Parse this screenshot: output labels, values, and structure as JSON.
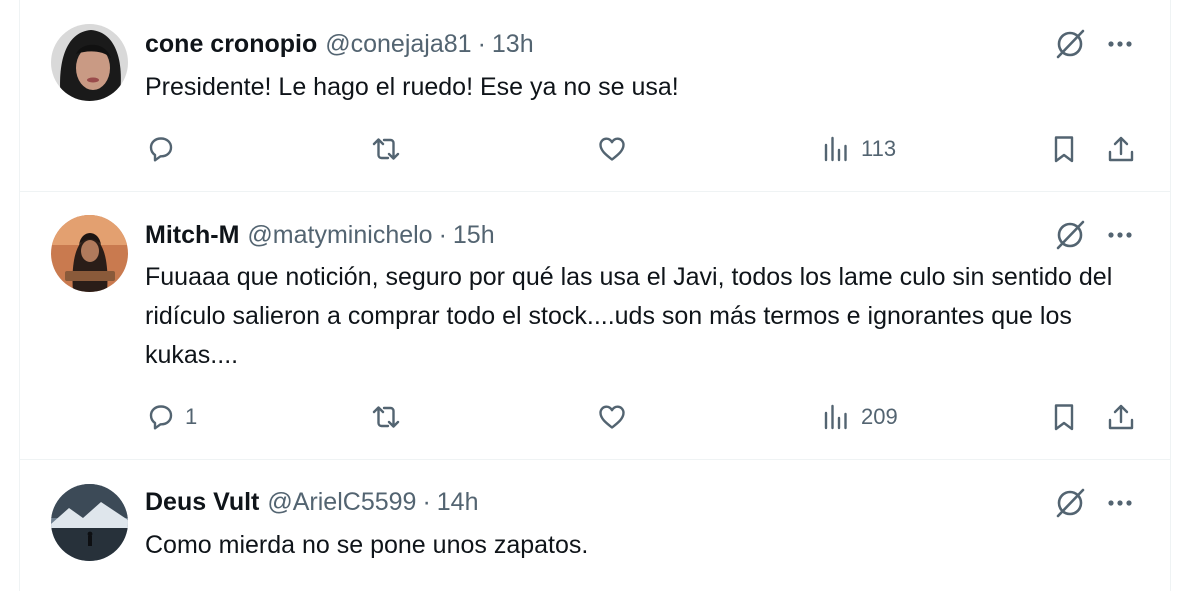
{
  "tweets": [
    {
      "display_name": "cone cronopio",
      "handle": "@conejaja81",
      "separator": "·",
      "time": "13h",
      "text": "Presidente! Le hago el ruedo! Ese ya no se usa!",
      "reply_count": "",
      "retweet_count": "",
      "like_count": "",
      "views": "113"
    },
    {
      "display_name": "Mitch-M",
      "handle": "@matyminichelo",
      "separator": "·",
      "time": "15h",
      "text": "Fuuaaa que notición, seguro por qué las usa el Javi, todos los lame culo sin sentido del ridículo salieron a comprar todo el stock....uds son más termos e ignorantes que los kukas....",
      "reply_count": "1",
      "retweet_count": "",
      "like_count": "",
      "views": "209"
    },
    {
      "display_name": "Deus Vult",
      "handle": "@ArielC5599",
      "separator": "·",
      "time": "14h",
      "text": "Como mierda no se pone unos zapatos."
    }
  ],
  "icons": {
    "reply": "reply-icon",
    "retweet": "retweet-icon",
    "like": "like-icon",
    "views": "views-icon",
    "bookmark": "bookmark-icon",
    "share": "share-icon",
    "grok": "grok-icon",
    "more": "more-icon"
  },
  "colors": {
    "text_primary": "#0f1419",
    "text_secondary": "#536471",
    "divider": "#eff3f4"
  }
}
